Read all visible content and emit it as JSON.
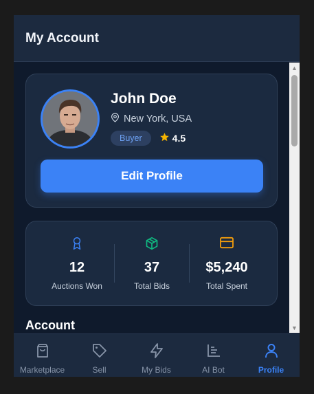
{
  "header": {
    "title": "My Account"
  },
  "profile": {
    "name": "John Doe",
    "location": "New York, USA",
    "badge": "Buyer",
    "rating": "4.5",
    "edit_button": "Edit Profile"
  },
  "stats": [
    {
      "icon": "award-icon",
      "value": "12",
      "label": "Auctions Won",
      "color": "#3b82f6"
    },
    {
      "icon": "box-icon",
      "value": "37",
      "label": "Total Bids",
      "color": "#10b981"
    },
    {
      "icon": "credit-card-icon",
      "value": "$5,240",
      "label": "Total Spent",
      "color": "#f59e0b"
    }
  ],
  "section": {
    "title": "Account"
  },
  "nav": {
    "items": [
      {
        "label": "Marketplace",
        "icon": "shopping-bag-icon"
      },
      {
        "label": "Sell",
        "icon": "tag-icon"
      },
      {
        "label": "My Bids",
        "icon": "lightning-icon"
      },
      {
        "label": "AI Bot",
        "icon": "chart-icon"
      },
      {
        "label": "Profile",
        "icon": "user-icon"
      }
    ],
    "active": "Profile"
  },
  "colors": {
    "accent": "#3b82f6",
    "background": "#0f1a2c",
    "card": "#1b2a40",
    "star": "#f5b400"
  }
}
